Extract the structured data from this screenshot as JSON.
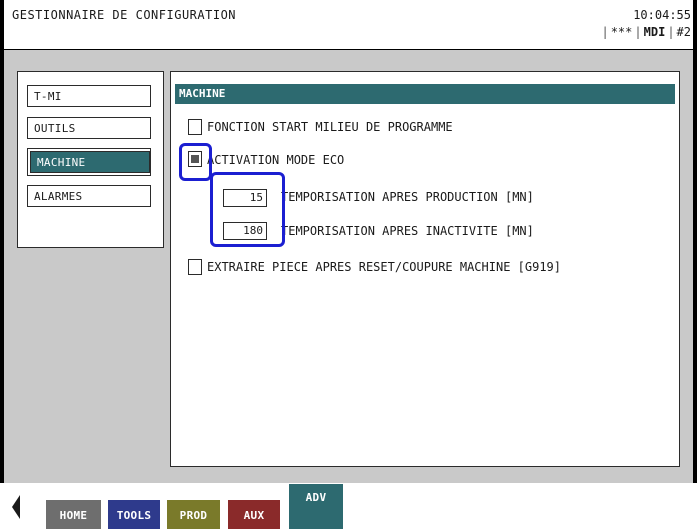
{
  "header": {
    "app_title": "GESTIONNAIRE DE CONFIGURATION",
    "clock": "10:04:55",
    "status": {
      "stars": "***",
      "mode": "MDI",
      "channel": "#2"
    }
  },
  "nav": {
    "items": [
      {
        "label": "T-MI",
        "active": false
      },
      {
        "label": "OUTILS",
        "active": false
      },
      {
        "label": "MACHINE",
        "active": true
      },
      {
        "label": "ALARMES",
        "active": false
      }
    ]
  },
  "main": {
    "section_title": "MACHINE",
    "options": {
      "start_milieu": {
        "label": "FONCTION START MILIEU DE PROGRAMME",
        "checked": false
      },
      "mode_eco": {
        "label": "ACTIVATION MODE ECO",
        "checked": true
      },
      "tempo_production": {
        "value": "15",
        "label": "TEMPORISATION APRES PRODUCTION [MN]"
      },
      "tempo_inactivite": {
        "value": "180",
        "label": "TEMPORISATION APRES INACTIVITE [MN]"
      },
      "extraire_piece": {
        "label": "EXTRAIRE PIECE APRES RESET/COUPURE MACHINE [G919]",
        "checked": false
      }
    }
  },
  "footer": {
    "buttons": [
      {
        "label": "HOME",
        "color": "#6e6e6e"
      },
      {
        "label": "TOOLS",
        "color": "#2e3a8c"
      },
      {
        "label": "PROD",
        "color": "#7a7a2a"
      },
      {
        "label": "AUX",
        "color": "#8a2a2a"
      },
      {
        "label": "ADV",
        "color": "#2d6a70"
      }
    ]
  }
}
